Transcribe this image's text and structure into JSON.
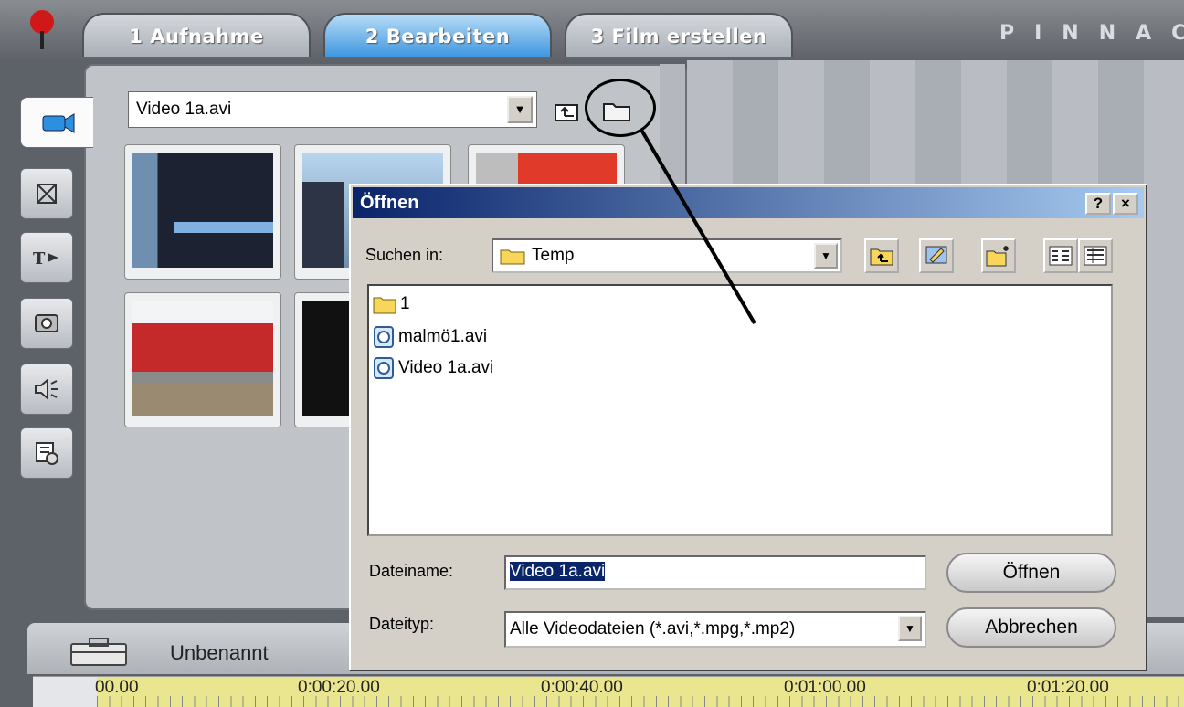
{
  "topbar": {
    "tabs": [
      {
        "label": "1 Aufnahme",
        "active": false
      },
      {
        "label": "2 Bearbeiten",
        "active": true
      },
      {
        "label": "3 Film erstellen",
        "active": false
      }
    ],
    "brand": "PINNAC"
  },
  "album": {
    "dropdown_value": "Video 1a.avi"
  },
  "timeline": {
    "project_name": "Unbenannt",
    "ruler": [
      "00.00",
      "0:00:20.00",
      "0:00:40.00",
      "0:01:00.00",
      "0:01:20.00"
    ]
  },
  "dialog": {
    "title": "Öffnen",
    "help_label": "?",
    "close_label": "×",
    "look_in_label": "Suchen in:",
    "look_in_value": "Temp",
    "files": [
      {
        "name": "1",
        "icon": "folder-icon"
      },
      {
        "name": "malmö1.avi",
        "icon": "video-file-icon"
      },
      {
        "name": "Video 1a.avi",
        "icon": "video-file-icon"
      }
    ],
    "filename_label": "Dateiname:",
    "filename_value": "Video 1a.avi",
    "filetype_label": "Dateityp:",
    "filetype_value": "Alle Videodateien (*.avi,*.mpg,*.mp2)",
    "open_button": "Öffnen",
    "cancel_button": "Abbrechen"
  },
  "colors": {
    "active_tab": "#3f97e0",
    "titlebar": "#0a246a",
    "ruler": "#eae690"
  }
}
